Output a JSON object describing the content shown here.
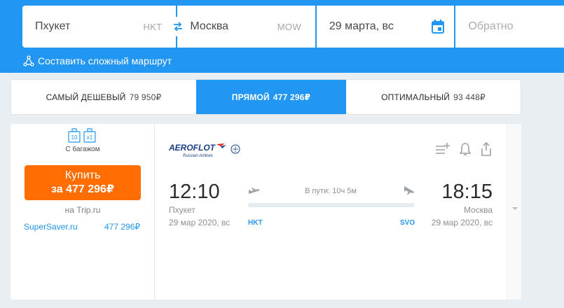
{
  "search": {
    "from_city": "Пхукет",
    "from_iata": "HKT",
    "to_city": "Москва",
    "to_iata": "MOW",
    "date": "29 марта, вс",
    "return_placeholder": "Обратно",
    "complex_route": "Составить сложный маршрут"
  },
  "tabs": [
    {
      "label": "САМЫЙ ДЕШЕВЫЙ",
      "price": "79 950₽"
    },
    {
      "label": "ПРЯМОЙ",
      "price": "477 296₽"
    },
    {
      "label": "ОПТИМАЛЬНЫЙ",
      "price": "93 448₽"
    }
  ],
  "ticket": {
    "baggage_icons": [
      "10",
      "x1"
    ],
    "baggage_label": "С багажом",
    "buy_line1": "Купить",
    "buy_line2": "за 477 296₽",
    "vendor": "на Trip.ru",
    "alt_agent": "SuperSaver.ru",
    "alt_price": "477 296₽",
    "airline": "AEROFLOT",
    "airline_sub": "Russian Airlines",
    "dep_time": "12:10",
    "arr_time": "18:15",
    "dep_city": "Пхукет",
    "arr_city": "Москва",
    "dep_date": "29 мар 2020, вс",
    "arr_date": "29 мар 2020, вс",
    "duration": "В пути: 10ч 5м",
    "dep_iata": "HKT",
    "arr_iata": "SVO"
  },
  "colors": {
    "brand_blue": "#2196f3",
    "buy_orange": "#ff6d00"
  }
}
